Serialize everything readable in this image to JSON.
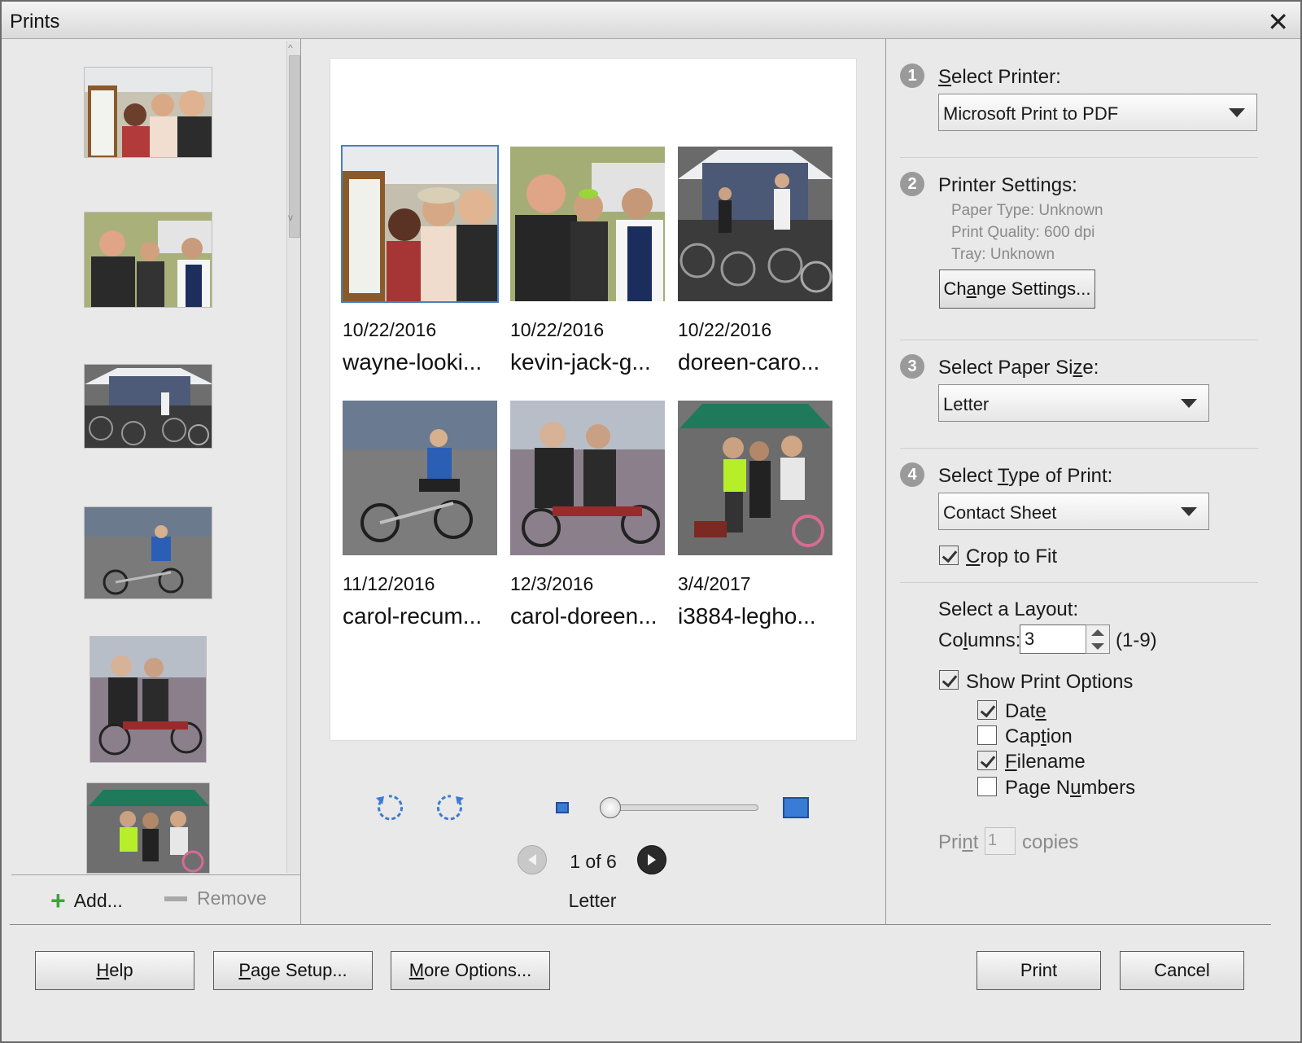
{
  "window": {
    "title": "Prints",
    "close_glyph": "✕"
  },
  "left_panel": {
    "add_label": "Add...",
    "remove_label": "Remove"
  },
  "preview": {
    "cells": [
      {
        "date": "10/22/2016",
        "filename": "wayne-looki..."
      },
      {
        "date": "10/22/2016",
        "filename": "kevin-jack-g..."
      },
      {
        "date": "10/22/2016",
        "filename": "doreen-caro..."
      },
      {
        "date": "11/12/2016",
        "filename": "carol-recum..."
      },
      {
        "date": "12/3/2016",
        "filename": "carol-doreen..."
      },
      {
        "date": "3/4/2017",
        "filename": "i3884-legho..."
      }
    ],
    "page_info": "1 of 6",
    "paper_label": "Letter"
  },
  "settings": {
    "step1": {
      "num": "1",
      "label_pre": "",
      "label_u": "S",
      "label_post": "elect Printer:",
      "value": "Microsoft Print to PDF"
    },
    "step2": {
      "num": "2",
      "label": "Printer Settings:",
      "paper_type": "Paper Type: Unknown",
      "print_quality": "Print Quality: 600 dpi",
      "tray": "Tray: Unknown",
      "change_pre": "Ch",
      "change_u": "a",
      "change_post": "nge Settings..."
    },
    "step3": {
      "num": "3",
      "label_pre": "Select Paper Si",
      "label_u": "z",
      "label_post": "e:",
      "value": "Letter"
    },
    "step4": {
      "num": "4",
      "label_pre": "Select ",
      "label_u": "T",
      "label_post": "ype of Print:",
      "value": "Contact Sheet"
    },
    "crop": {
      "pre": "",
      "u": "C",
      "post": "rop to Fit",
      "checked": true
    },
    "layout_label": "Select a Layout:",
    "columns": {
      "pre": "Co",
      "u": "l",
      "post": "umns:",
      "value": "3",
      "range": "(1-9)"
    },
    "show_print_options": {
      "label": "Show Print Options",
      "checked": true
    },
    "options": {
      "date": {
        "pre": "Dat",
        "u": "e",
        "post": "",
        "checked": true
      },
      "caption": {
        "pre": "Cap",
        "u": "t",
        "post": "ion",
        "checked": false
      },
      "filename": {
        "pre": "",
        "u": "F",
        "post": "ilename",
        "checked": true
      },
      "page_numbers": {
        "pre": "Page N",
        "u": "u",
        "post": "mbers",
        "checked": false
      }
    },
    "copies": {
      "pre": "Pri",
      "u": "n",
      "post": "t",
      "value": "1",
      "suffix": "copies"
    }
  },
  "footer": {
    "help": {
      "u": "H",
      "post": "elp"
    },
    "page_setup": {
      "u": "P",
      "post": "age Setup..."
    },
    "more_options": {
      "u": "M",
      "post": "ore Options..."
    },
    "print": "Print",
    "cancel": "Cancel"
  },
  "colors": {
    "accent": "#3a7bd5",
    "selection": "#4a7fc1",
    "add_green": "#3aa53a"
  }
}
